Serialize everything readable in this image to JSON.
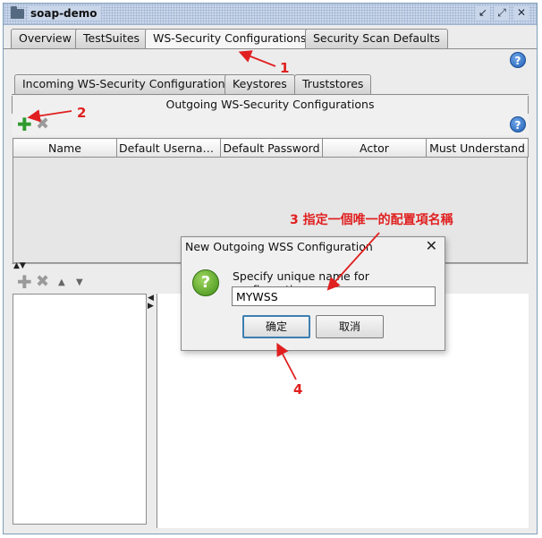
{
  "window": {
    "title": "soap-demo",
    "buttons": [
      "↙",
      "⤢",
      "✕"
    ]
  },
  "tabs": [
    {
      "label": "Overview",
      "active": false
    },
    {
      "label": "TestSuites",
      "active": false
    },
    {
      "label": "WS-Security Configurations",
      "active": true
    },
    {
      "label": "Security Scan Defaults",
      "active": false
    }
  ],
  "inner_tabs": [
    {
      "label": "Incoming WS-Security Configurations",
      "active": false
    },
    {
      "label": "Keystores",
      "active": false
    },
    {
      "label": "Truststores",
      "active": false
    }
  ],
  "section": {
    "title": "Outgoing WS-Security Configurations"
  },
  "help_glyph": "?",
  "toolbar": {
    "add_glyph": "✚",
    "remove_glyph": "✖"
  },
  "table": {
    "columns": [
      "Name",
      "Default Username…",
      "Default Password",
      "Actor",
      "Must Understand"
    ]
  },
  "splitter": {
    "glyphs": "▲▼"
  },
  "lower_toolbar": {
    "add_glyph": "✚",
    "remove_glyph": "✖",
    "up_glyph": "▲",
    "down_glyph": "▼"
  },
  "dialog": {
    "title": "New Outgoing WSS Configuration",
    "close_glyph": "✕",
    "icon_glyph": "?",
    "label": "Specify unique name for configuration",
    "value": "MYWSS",
    "ok_label": "确定",
    "cancel_label": "取消"
  },
  "annotations": {
    "n1": "1",
    "n2": "2",
    "n3": "3 指定一個唯一的配置項名稱",
    "n4": "4",
    "color": "#e02020"
  }
}
